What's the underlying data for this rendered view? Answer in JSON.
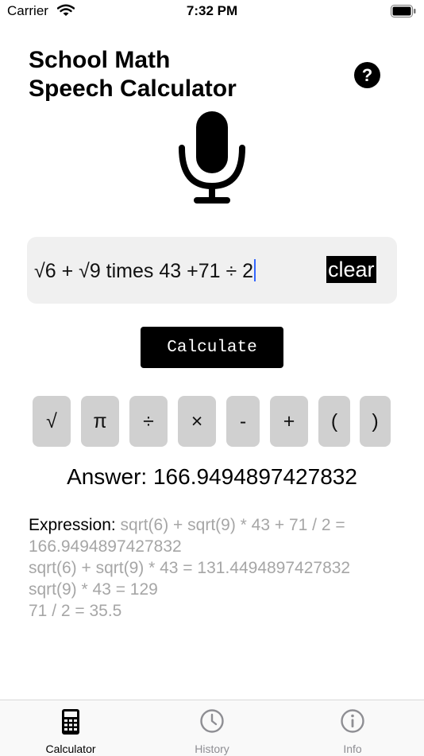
{
  "status": {
    "carrier": "Carrier",
    "time": "7:32 PM"
  },
  "title": {
    "line1": "School Math",
    "line2": "Speech Calculator"
  },
  "help_label": "?",
  "input": {
    "value": "√6 + √9 times 43 +71 ÷ 2"
  },
  "clear_label": "clear",
  "calculate_label": "Calculate",
  "symbols": [
    "√",
    "π",
    "÷",
    "×",
    "-",
    "+",
    "(",
    ")"
  ],
  "answer": "Answer: 166.9494897427832",
  "expression": {
    "label": "Expression:",
    "first": " sqrt(6) + sqrt(9) * 43 + 71 / 2 = 166.9494897427832",
    "lines": [
      "sqrt(6) + sqrt(9) * 43 = 131.4494897427832",
      "sqrt(9) * 43 = 129",
      "71 / 2 = 35.5"
    ]
  },
  "tabs": [
    {
      "label": "Calculator",
      "icon": "calculator-icon",
      "active": true
    },
    {
      "label": "History",
      "icon": "clock-icon",
      "active": false
    },
    {
      "label": "Info",
      "icon": "info-icon",
      "active": false
    }
  ],
  "colors": {
    "active_tab": "#000000",
    "inactive_tab": "#8e8e93",
    "muted_text": "#a6a6a6",
    "input_bg": "#f0f0f0",
    "key_bg": "#d0d0d0"
  }
}
